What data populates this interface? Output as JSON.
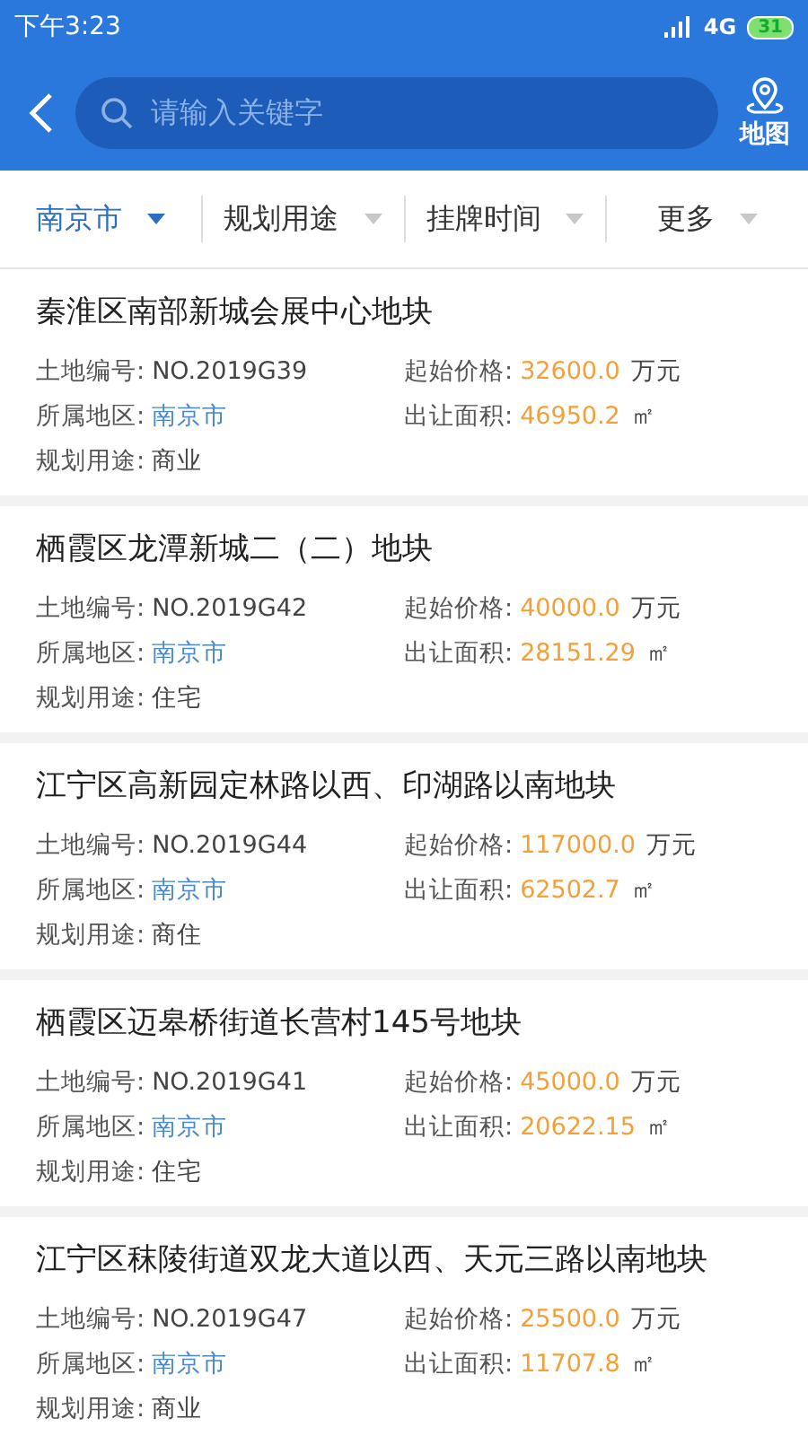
{
  "status_bar": {
    "time": "下午3:23",
    "network": "4G",
    "battery": "31"
  },
  "header": {
    "search": {
      "placeholder": "请输入关键字"
    },
    "map_label": "地图"
  },
  "filters": [
    {
      "label": "南京市",
      "selected": true
    },
    {
      "label": "规划用途",
      "selected": false
    },
    {
      "label": "挂牌时间",
      "selected": false
    },
    {
      "label": "更多",
      "selected": false
    }
  ],
  "listings": [
    {
      "title": "秦淮区南部新城会展中心地块",
      "fields": [
        {
          "label": "土地编号:",
          "value": "NO.2019G39",
          "kind": "plain"
        },
        {
          "label": "起始价格:",
          "value": "32600.0",
          "unit": "万元",
          "kind": "price"
        },
        {
          "label": "所属地区:",
          "value": "南京市",
          "kind": "link"
        },
        {
          "label": "出让面积:",
          "value": "46950.2",
          "unit": "㎡",
          "kind": "price"
        },
        {
          "label": "规划用途:",
          "value": "商业",
          "kind": "plain"
        }
      ]
    },
    {
      "title": "栖霞区龙潭新城二（二）地块",
      "fields": [
        {
          "label": "土地编号:",
          "value": "NO.2019G42",
          "kind": "plain"
        },
        {
          "label": "起始价格:",
          "value": "40000.0",
          "unit": "万元",
          "kind": "price"
        },
        {
          "label": "所属地区:",
          "value": "南京市",
          "kind": "link"
        },
        {
          "label": "出让面积:",
          "value": "28151.29",
          "unit": "㎡",
          "kind": "price"
        },
        {
          "label": "规划用途:",
          "value": "住宅",
          "kind": "plain"
        }
      ]
    },
    {
      "title": "江宁区高新园定林路以西、印湖路以南地块",
      "fields": [
        {
          "label": "土地编号:",
          "value": "NO.2019G44",
          "kind": "plain"
        },
        {
          "label": "起始价格:",
          "value": "117000.0",
          "unit": "万元",
          "kind": "price"
        },
        {
          "label": "所属地区:",
          "value": "南京市",
          "kind": "link"
        },
        {
          "label": "出让面积:",
          "value": "62502.7",
          "unit": "㎡",
          "kind": "price"
        },
        {
          "label": "规划用途:",
          "value": "商住",
          "kind": "plain"
        }
      ]
    },
    {
      "title": "栖霞区迈皋桥街道长营村145号地块",
      "fields": [
        {
          "label": "土地编号:",
          "value": "NO.2019G41",
          "kind": "plain"
        },
        {
          "label": "起始价格:",
          "value": "45000.0",
          "unit": "万元",
          "kind": "price"
        },
        {
          "label": "所属地区:",
          "value": "南京市",
          "kind": "link"
        },
        {
          "label": "出让面积:",
          "value": "20622.15",
          "unit": "㎡",
          "kind": "price"
        },
        {
          "label": "规划用途:",
          "value": "住宅",
          "kind": "plain"
        }
      ]
    },
    {
      "title": "江宁区秣陵街道双龙大道以西、天元三路以南地块",
      "fields": [
        {
          "label": "土地编号:",
          "value": "NO.2019G47",
          "kind": "plain"
        },
        {
          "label": "起始价格:",
          "value": "25500.0",
          "unit": "万元",
          "kind": "price"
        },
        {
          "label": "所属地区:",
          "value": "南京市",
          "kind": "link"
        },
        {
          "label": "出让面积:",
          "value": "11707.8",
          "unit": "㎡",
          "kind": "price"
        },
        {
          "label": "规划用途:",
          "value": "商业",
          "kind": "plain"
        }
      ]
    }
  ]
}
